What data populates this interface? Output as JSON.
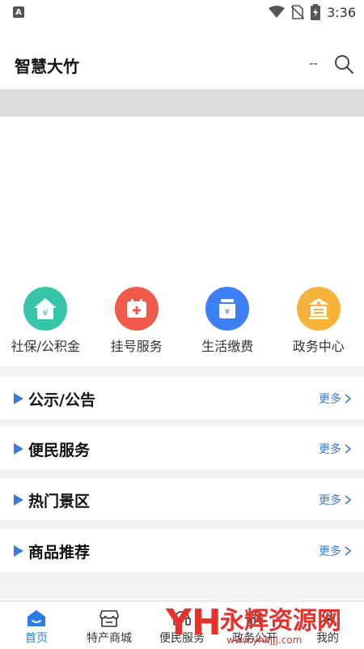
{
  "status_bar": {
    "time": "3:36"
  },
  "header": {
    "title": "智慧大竹",
    "dash": "--"
  },
  "quick_access": [
    {
      "label": "社保/公积金",
      "icon": "social-security-house-icon",
      "color": "#36c5a8"
    },
    {
      "label": "挂号服务",
      "icon": "medical-registration-icon",
      "color": "#f05a4a"
    },
    {
      "label": "生活缴费",
      "icon": "bill-payment-jar-icon",
      "color": "#3d7ff5"
    },
    {
      "label": "政务中心",
      "icon": "government-building-icon",
      "color": "#f6b33a"
    }
  ],
  "sections": [
    {
      "title": "公示/公告",
      "more": "更多"
    },
    {
      "title": "便民服务",
      "more": "更多"
    },
    {
      "title": "热门景区",
      "more": "更多"
    },
    {
      "title": "商品推荐",
      "more": "更多"
    }
  ],
  "bottom_nav": [
    {
      "label": "首页",
      "icon": "home-icon",
      "active": true
    },
    {
      "label": "特产商城",
      "icon": "store-icon",
      "active": false
    },
    {
      "label": "便民服务",
      "icon": "service-icon",
      "active": false
    },
    {
      "label": "政务公开",
      "icon": "government-icon",
      "active": false
    },
    {
      "label": "我的",
      "icon": "profile-icon",
      "active": false
    }
  ],
  "watermark": {
    "text": "永辉资源网",
    "url": "www.yhkjjj.com"
  },
  "colors": {
    "accent": "#2b7de9",
    "link": "#3a7bd5"
  }
}
